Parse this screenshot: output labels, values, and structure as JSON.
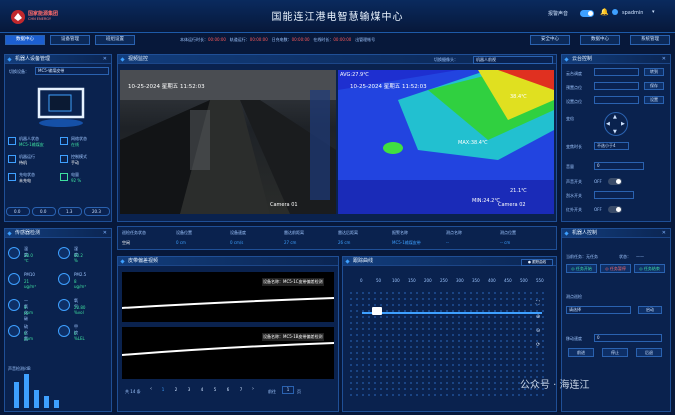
{
  "header": {
    "title": "国能连江港电智慧输煤中心",
    "brand_cn": "国家能源集团",
    "brand_en": "CHN ENERGY",
    "alarm_label": "报警声音",
    "user": "spadmin"
  },
  "nav": {
    "left": [
      "数据中心",
      "设备管理",
      "班组设置"
    ],
    "right": [
      "安全中心",
      "数据中心",
      "系统管理"
    ]
  },
  "statusbar": {
    "items": [
      "本体运行时长：",
      "00:00:00",
      "轨道运行：",
      "00:00:00",
      "日充电数：",
      "00:00:00",
      "在线时长：",
      "00:00:00",
      "出管理帐号"
    ]
  },
  "robot": {
    "title": "机器人设备管理",
    "device_label": "切换设备：",
    "device_value": "MC5-输煤皮带",
    "stats": [
      {
        "label": "机器人状态",
        "value": "MC5-1输煤皮"
      },
      {
        "label": "网络状态",
        "value": "在线"
      },
      {
        "label": "机器运行",
        "value": "待机"
      },
      {
        "label": "控制模式",
        "value": "手动"
      },
      {
        "label": "充电状态",
        "value": "未充电"
      },
      {
        "label": "电量",
        "value": "92 %"
      }
    ],
    "meters": [
      "0.0",
      "0.0",
      "1.3",
      "20.3"
    ]
  },
  "sensor": {
    "title": "传感器检测",
    "items": [
      {
        "label": "温度",
        "value": "28.0 ℃"
      },
      {
        "label": "湿度",
        "value": "60.2 %"
      },
      {
        "label": "PM10",
        "value": "21 ug/m³"
      },
      {
        "label": "PM2.5",
        "value": "8 ug/m³"
      },
      {
        "label": "一氧化碳",
        "value": "0 ppm"
      },
      {
        "label": "氧气",
        "value": "20.80 %vol"
      },
      {
        "label": "硫化氢",
        "value": "0 ppm"
      },
      {
        "label": "甲烷",
        "value": "0 %LEL"
      }
    ],
    "noise_label": "声音检测/dB"
  },
  "video": {
    "title": "视频监控",
    "select_label": "切换摄像头：",
    "select_value": "机器人前视",
    "cam1_time": "10-25-2024 星期五 11:52:03",
    "cam1_tag": "Camera 01",
    "cam2_avg": "AVG:27.9℃",
    "cam2_time": "10-25-2024 星期五 11:52:03",
    "cam2_max": "MAX:38.4℃",
    "cam2_hi": "38.4℃",
    "cam2_lo": "21.1℃",
    "cam2_min": "MIN:24.2℃",
    "cam2_tag": "Camera 02"
  },
  "table": {
    "headers": [
      "巡检任务状态",
      "设备位置",
      "设备速度",
      "雷达前距离",
      "雷达后距离",
      "报警名称",
      "测点名称",
      "测点位置"
    ],
    "values": [
      "空闲",
      "0 cm",
      "0 cm/s",
      "27 cm",
      "26 cm",
      "MC5-1输煤皮带",
      "--",
      "-- cm"
    ]
  },
  "belt": {
    "title": "皮带偏差视频",
    "label1": "设备名称：MC5-1C皮带偏差检测",
    "label2": "设备名称：MC5-1B皮带偏差检测",
    "pager_total": "共 14 条",
    "pages": [
      "1",
      "2",
      "3",
      "4",
      "5",
      "6",
      "7"
    ],
    "goto": "前往",
    "goto_page": "1",
    "unit": "页"
  },
  "track": {
    "title": "跟踪曲线",
    "btn": "● 跟踪曲线",
    "axis": [
      "0",
      "50",
      "100",
      "150",
      "200",
      "250",
      "300",
      "350",
      "400",
      "450",
      "500",
      "550"
    ]
  },
  "gimbal": {
    "title": "云台控制",
    "rows": [
      {
        "label": "云台调度",
        "btn": "转到"
      },
      {
        "label": "预置点位",
        "btn": "保存"
      },
      {
        "label": "设置点位",
        "btn": "设置"
      }
    ],
    "tilt_label": "变倍",
    "focus_label": "变焦时长",
    "focus_val": "不选小于4",
    "light_label": "声音开关",
    "light_state": "OFF",
    "wiper_label": "刮水开关",
    "wiper_state": "OFF",
    "ir_label": "红外开关",
    "ir_state": "OFF",
    "zoom_label": "音量",
    "zoom_val": "0"
  },
  "ctrl": {
    "title": "机器人控制",
    "task_label": "当前任务：无任务",
    "state_label": "状态：",
    "state_val": "——",
    "btns": [
      "◎ 任务开始",
      "◎ 任务暂停",
      "◎ 任务结束"
    ],
    "point_label": "测点巡检",
    "point_sel": "请选择",
    "start": "启动",
    "move_label": "移动速度",
    "move_val": "0",
    "fwd": "前进",
    "stop": "停止",
    "back": "后退",
    "speed_label": "运行速度",
    "speed_val": "10 cm/s",
    "charge": "前往充电"
  },
  "watermark": "公众号 · 海连江"
}
